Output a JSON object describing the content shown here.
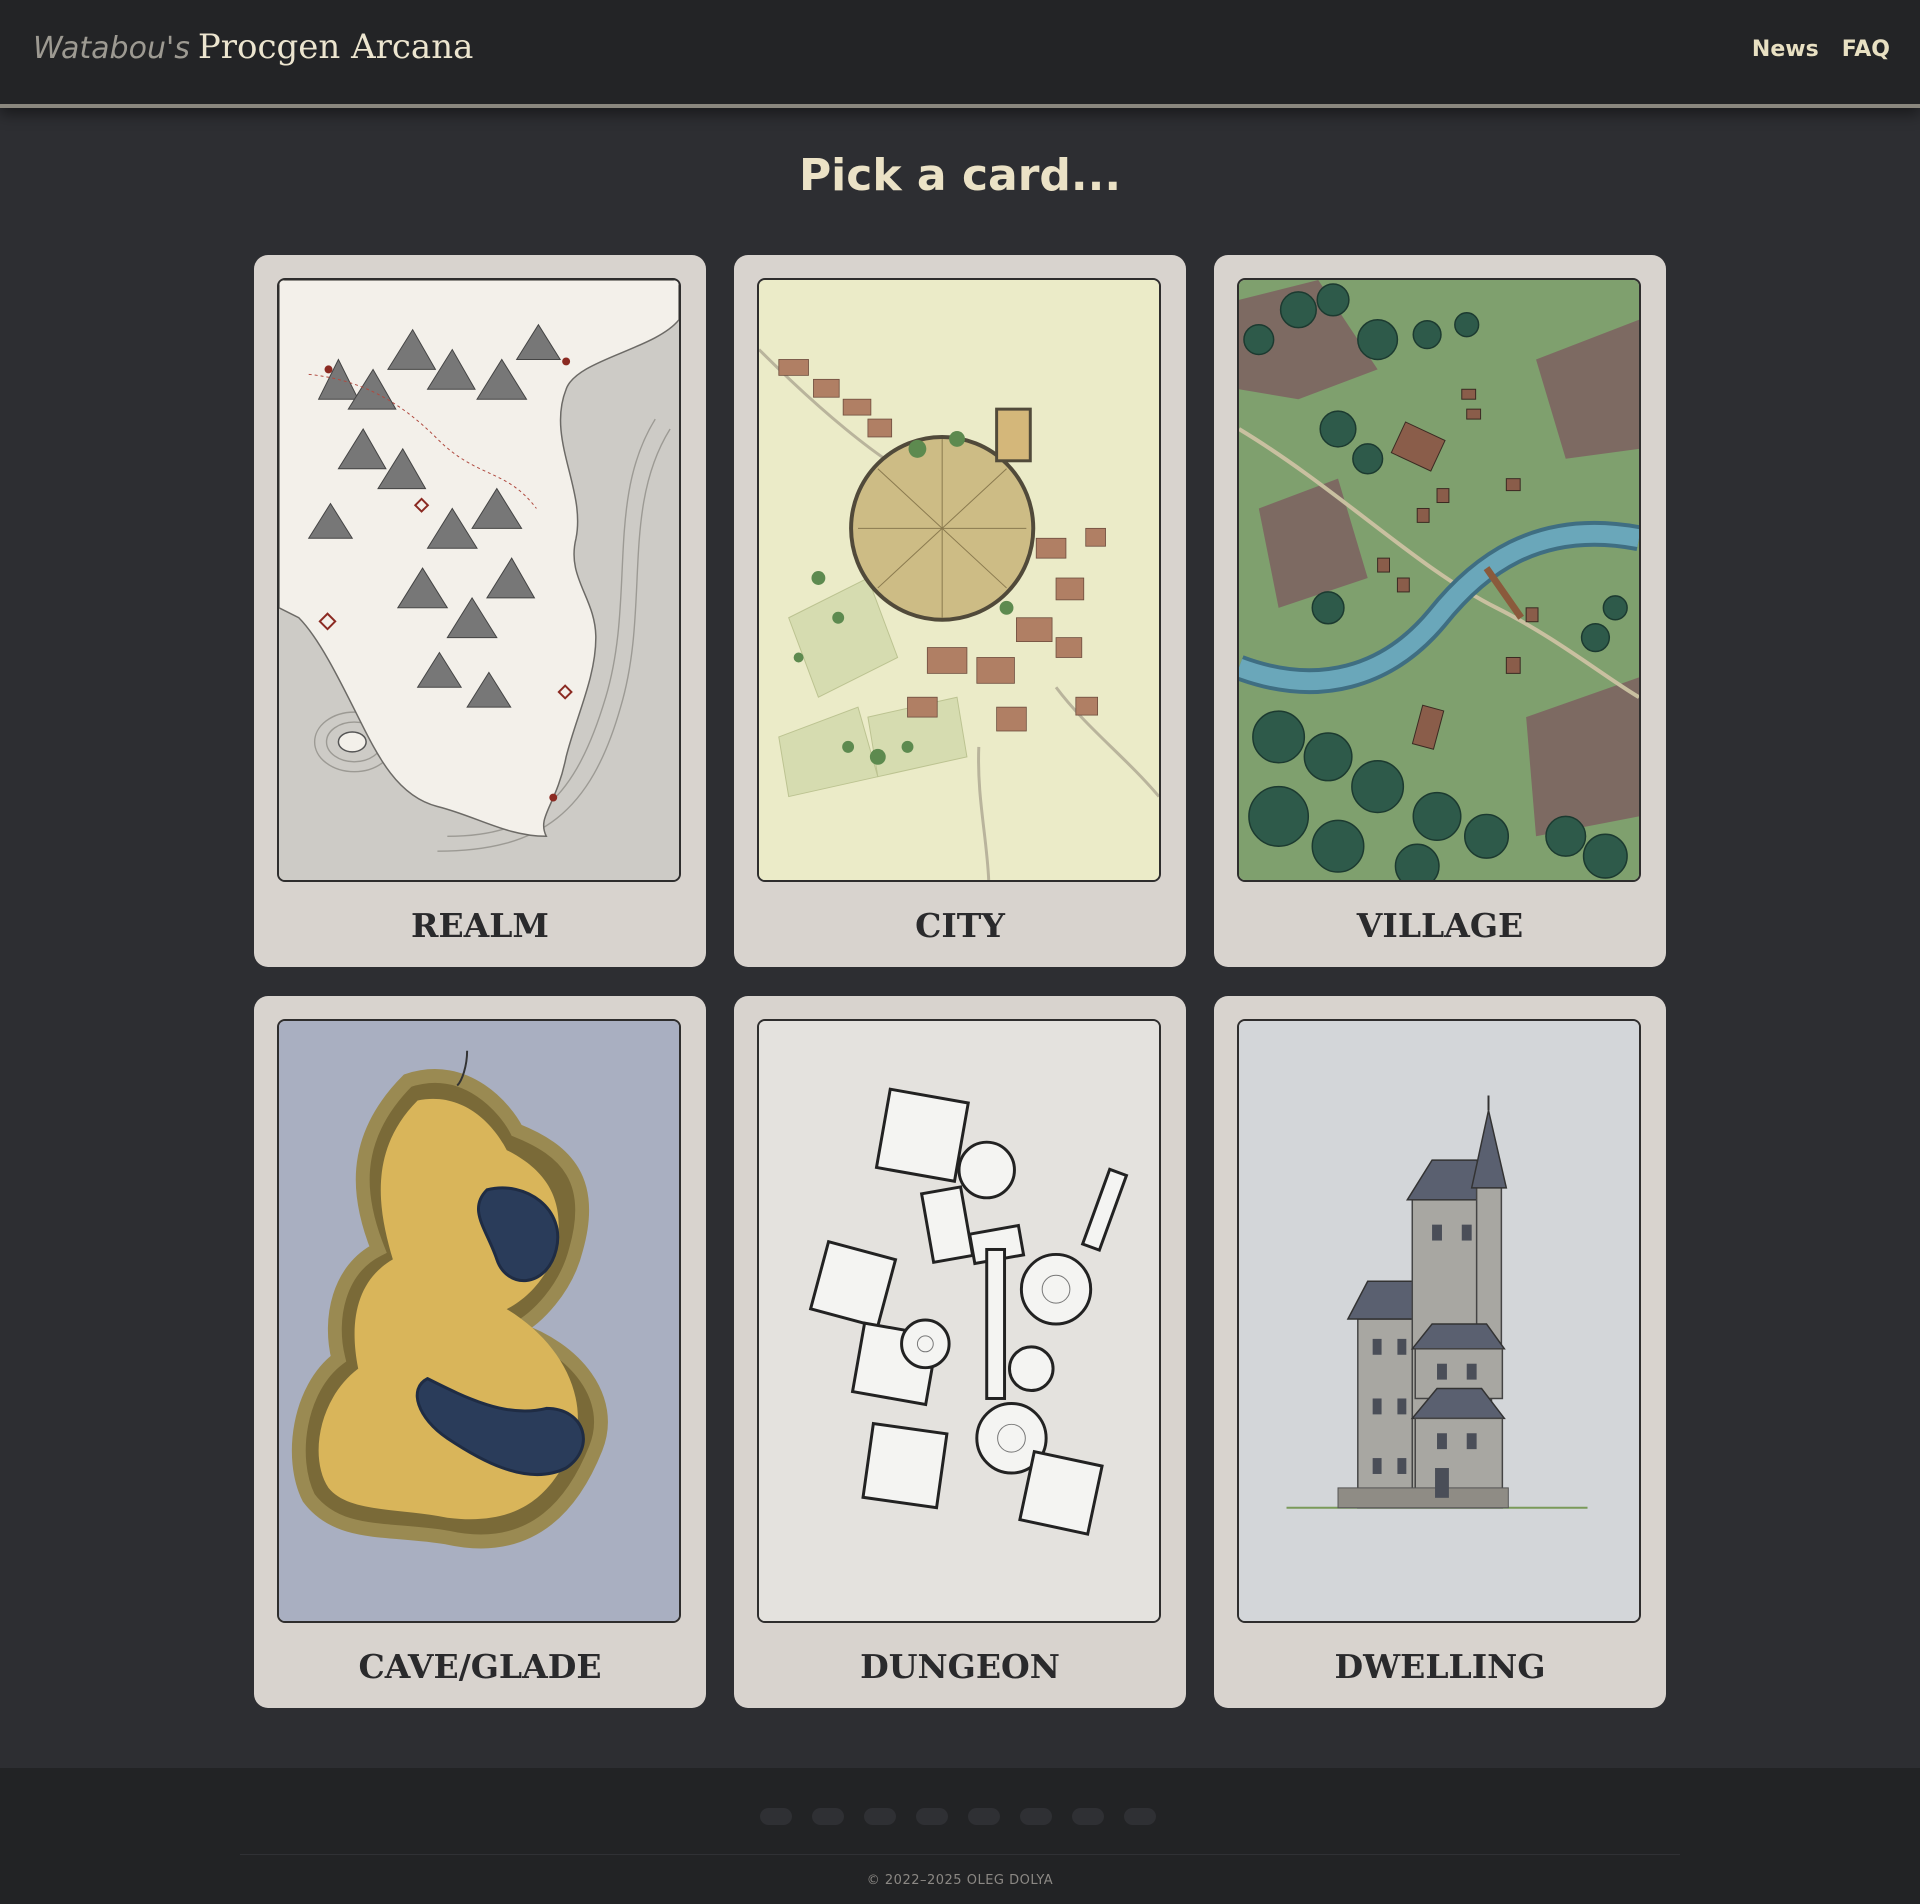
{
  "header": {
    "brand_prefix": "Watabou's",
    "brand_title": "Procgen Arcana",
    "nav": [
      {
        "label": "News"
      },
      {
        "label": "FAQ"
      }
    ]
  },
  "main": {
    "heading": "Pick a card...",
    "cards": [
      {
        "label": "REALM",
        "icon": "realm-map-illustration",
        "bg": "#f3f0ea"
      },
      {
        "label": "CITY",
        "icon": "city-map-illustration",
        "bg": "#ebebc8"
      },
      {
        "label": "VILLAGE",
        "icon": "village-map-illustration",
        "bg": "#7fa06e"
      },
      {
        "label": "CAVE/GLADE",
        "icon": "cave-glade-map-illustration",
        "bg": "#a9afc1"
      },
      {
        "label": "DUNGEON",
        "icon": "dungeon-map-illustration",
        "bg": "#e4e2de"
      },
      {
        "label": "DWELLING",
        "icon": "dwelling-building-illustration",
        "bg": "#d3d6d9"
      }
    ]
  },
  "footer": {
    "dot_count": 8,
    "copyright": "© 2022–2025 OLEG DOLYA"
  },
  "colors": {
    "page_bg": "#2d2e32",
    "header_bg": "#232426",
    "accent_text": "#ebe2c6",
    "card_bg": "#d8d3ce"
  }
}
